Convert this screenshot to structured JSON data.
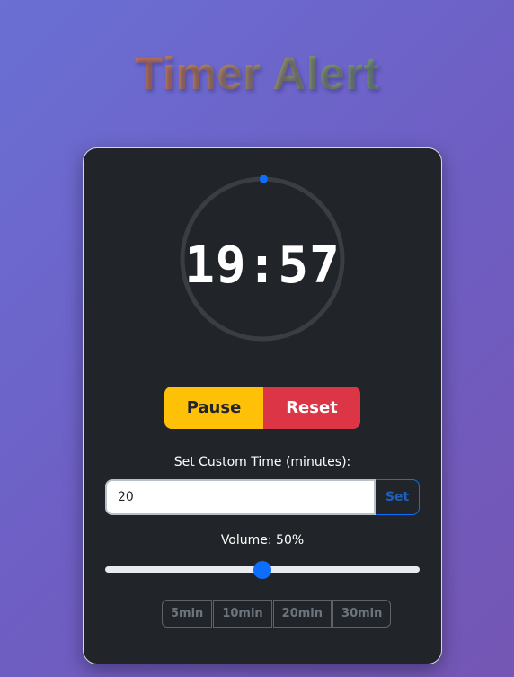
{
  "app": {
    "title": "Timer Alert"
  },
  "timer": {
    "display": "19:57",
    "progress_fraction": 0.9975,
    "ring_color": "#3a3d41",
    "indicator_color": "#0d6efd"
  },
  "controls": {
    "pause_label": "Pause",
    "reset_label": "Reset"
  },
  "custom_time": {
    "label": "Set Custom Time (minutes):",
    "value": "20",
    "set_label": "Set"
  },
  "volume": {
    "label": "Volume: 50%",
    "level_fraction": 0.5
  },
  "presets": [
    {
      "label": "5min"
    },
    {
      "label": "10min"
    },
    {
      "label": "20min"
    },
    {
      "label": "30min"
    }
  ],
  "colors": {
    "card_background": "#212529",
    "pause": "#ffc107",
    "reset": "#dc3545",
    "accent": "#0d6efd"
  }
}
